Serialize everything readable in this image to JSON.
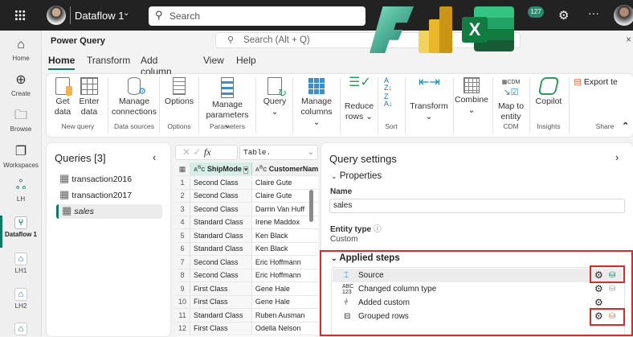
{
  "topbar": {
    "app_title": "Dataflow 1",
    "search_placeholder": "Search",
    "notification_count": "127",
    "icons": [
      "waffle-icon",
      "avatar",
      "chevron-down-icon",
      "search-icon",
      "notification-icon",
      "gear-icon",
      "more-icon"
    ]
  },
  "rail": [
    {
      "label": "Home",
      "icon": "home-icon"
    },
    {
      "label": "Create",
      "icon": "plus-circle-icon"
    },
    {
      "label": "Browse",
      "icon": "folder-icon"
    },
    {
      "label": "Workspaces",
      "icon": "workspaces-icon"
    },
    {
      "label": "LH",
      "icon": "people-icon"
    },
    {
      "label": "Dataflow 1",
      "icon": "dataflow-icon",
      "active": true
    },
    {
      "label": "LH1",
      "icon": "lakehouse-icon"
    },
    {
      "label": "LH2",
      "icon": "lakehouse-icon"
    }
  ],
  "powerquery": {
    "title": "Power Query",
    "search_placeholder": "Search (Alt + Q)"
  },
  "tabs": [
    {
      "label": "Home",
      "active": true
    },
    {
      "label": "Transform"
    },
    {
      "label": "Add column"
    },
    {
      "label": "View"
    },
    {
      "label": "Help"
    }
  ],
  "ribbon": {
    "buttons": {
      "get_data": "Get data",
      "enter_data": "Enter data",
      "manage_connections": "Manage connections",
      "options": "Options",
      "manage_parameters": "Manage parameters",
      "query": "Query",
      "manage_columns": "Manage columns",
      "reduce_rows": "Reduce rows",
      "transform": "Transform",
      "combine": "Combine",
      "map_to_entity": "Map to entity",
      "copilot": "Copilot",
      "export": "Export te"
    },
    "groups": {
      "new_query": "New query",
      "data_sources": "Data sources",
      "options": "Options",
      "parameters": "Parameters",
      "sort": "Sort",
      "cdm": "CDM",
      "insights": "Insights",
      "share": "Share"
    }
  },
  "queries": {
    "title": "Queries [3]",
    "items": [
      {
        "name": "transaction2016"
      },
      {
        "name": "transaction2017"
      },
      {
        "name": "sales",
        "selected": true
      }
    ]
  },
  "formula": {
    "value": "Table."
  },
  "grid": {
    "columns": [
      "ShipMode",
      "CustomerName"
    ],
    "rows": [
      [
        "1",
        "Second Class",
        "Claire Gute"
      ],
      [
        "2",
        "Second Class",
        "Claire Gute"
      ],
      [
        "3",
        "Second Class",
        "Darrin Van Huff"
      ],
      [
        "4",
        "Standard Class",
        "Irene Maddox"
      ],
      [
        "5",
        "Standard Class",
        "Ken Black"
      ],
      [
        "6",
        "Standard Class",
        "Ken Black"
      ],
      [
        "7",
        "Second Class",
        "Eric Hoffmann"
      ],
      [
        "8",
        "Second Class",
        "Eric Hoffmann"
      ],
      [
        "9",
        "First Class",
        "Gene Hale"
      ],
      [
        "10",
        "First Class",
        "Gene Hale"
      ],
      [
        "11",
        "Standard Class",
        "Ruben Ausman"
      ],
      [
        "12",
        "First Class",
        "Odella Nelson"
      ]
    ]
  },
  "settings": {
    "title": "Query settings",
    "properties": "Properties",
    "name_label": "Name",
    "name_value": "sales",
    "entity_label": "Entity type",
    "entity_value": "Custom",
    "applied_steps": "Applied steps",
    "steps": [
      {
        "name": "Source",
        "icon": "source-icon",
        "selected": true
      },
      {
        "name": "Changed column type",
        "icon": "abc123-icon"
      },
      {
        "name": "Added custom",
        "icon": "custom-column-icon"
      },
      {
        "name": "Grouped rows",
        "icon": "group-icon"
      }
    ]
  },
  "colors": {
    "accent": "#117865",
    "highlight": "#d92b2b",
    "warning": "#e06a2c"
  }
}
